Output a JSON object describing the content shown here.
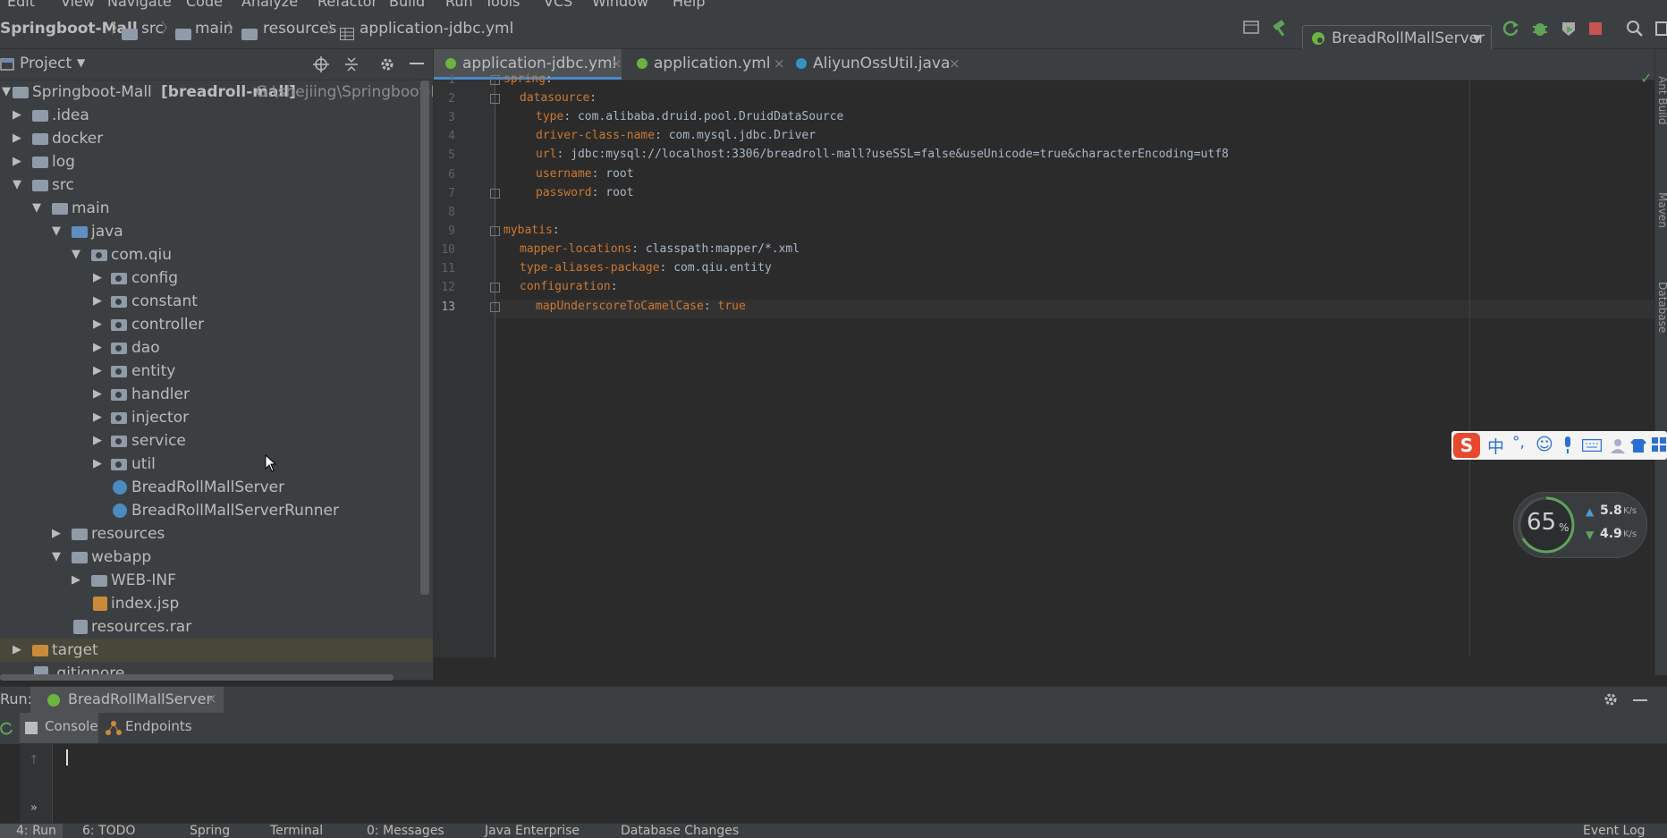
{
  "menu": [
    "Edit",
    "View",
    "Navigate",
    "Code",
    "Analyze",
    "Refactor",
    "Build",
    "Run",
    "Tools",
    "VCS",
    "Window",
    "Help"
  ],
  "breadcrumb": [
    "Springboot-Mall",
    "src",
    "main",
    "resources",
    "application-jdbc.yml"
  ],
  "run_config": "BreadRollMallServer",
  "project_panel": {
    "title": "Project"
  },
  "tree": [
    {
      "label": "Springboot-Mall",
      "extra": "[breadroll-mall]",
      "path": "G:\\shejiing\\Springboot-Mal"
    },
    {
      "label": ".idea"
    },
    {
      "label": "docker"
    },
    {
      "label": "log"
    },
    {
      "label": "src"
    },
    {
      "label": "main"
    },
    {
      "label": "java"
    },
    {
      "label": "com.qiu"
    },
    {
      "label": "config"
    },
    {
      "label": "constant"
    },
    {
      "label": "controller"
    },
    {
      "label": "dao"
    },
    {
      "label": "entity"
    },
    {
      "label": "handler"
    },
    {
      "label": "injector"
    },
    {
      "label": "service"
    },
    {
      "label": "util"
    },
    {
      "label": "BreadRollMallServer"
    },
    {
      "label": "BreadRollMallServerRunner"
    },
    {
      "label": "resources"
    },
    {
      "label": "webapp"
    },
    {
      "label": "WEB-INF"
    },
    {
      "label": "index.jsp"
    },
    {
      "label": "resources.rar"
    },
    {
      "label": "target"
    },
    {
      "label": ".gitignore"
    }
  ],
  "editor_tabs": [
    {
      "label": "application-jdbc.yml"
    },
    {
      "label": "application.yml"
    },
    {
      "label": "AliyunOssUtil.java"
    }
  ],
  "code_lines": [
    {
      "n": "1",
      "key": "spring",
      "val": ""
    },
    {
      "n": "2",
      "key": "datasource",
      "val": ""
    },
    {
      "n": "3",
      "key": "type",
      "val": "com.alibaba.druid.pool.DruidDataSource"
    },
    {
      "n": "4",
      "key": "driver-class-name",
      "val": "com.mysql.jdbc.Driver"
    },
    {
      "n": "5",
      "key": "url",
      "val": "jdbc:mysql://localhost:3306/breadroll-mall?useSSL=false&useUnicode=true&characterEncoding=utf8"
    },
    {
      "n": "6",
      "key": "username",
      "val": "root"
    },
    {
      "n": "7",
      "key": "password",
      "val": "root"
    },
    {
      "n": "8",
      "key": "",
      "val": ""
    },
    {
      "n": "9",
      "key": "mybatis",
      "val": ""
    },
    {
      "n": "10",
      "key": "mapper-locations",
      "val": "classpath:mapper/*.xml"
    },
    {
      "n": "11",
      "key": "type-aliases-package",
      "val": "com.qiu.entity"
    },
    {
      "n": "12",
      "key": "configuration",
      "val": ""
    },
    {
      "n": "13",
      "key": "mapUnderscoreToCamelCase",
      "val": "true"
    }
  ],
  "run": {
    "label": "Run:",
    "tab": "BreadRollMallServer",
    "console_tab": "Console",
    "endpoints_tab": "Endpoints"
  },
  "bottom_tabs": [
    "4: Run",
    "6: TODO",
    "Spring",
    "Terminal",
    "0: Messages",
    "Java Enterprise",
    "Database Changes",
    "Event Log"
  ],
  "right_strip": [
    "Ant Build",
    "Maven",
    "Database"
  ],
  "ime": {
    "logo": "S",
    "lang": "中",
    "punct": "°,"
  },
  "net_widget": {
    "percent": "65",
    "unit": "%",
    "up": "5.8",
    "down": "4.9",
    "rate_unit": "K/s"
  }
}
